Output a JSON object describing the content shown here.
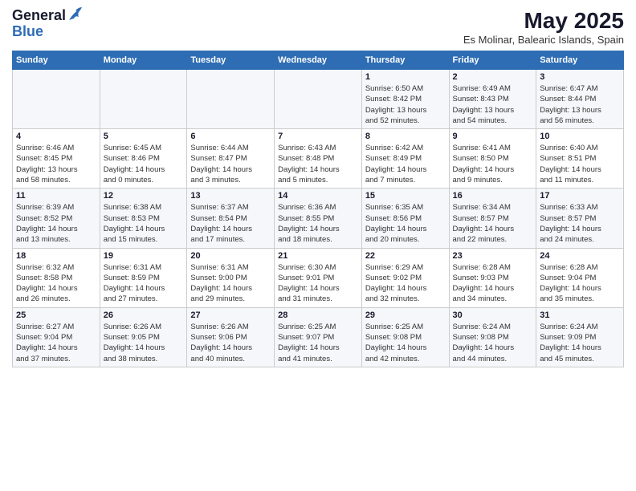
{
  "logo": {
    "general": "General",
    "blue": "Blue"
  },
  "title": "May 2025",
  "location": "Es Molinar, Balearic Islands, Spain",
  "headers": [
    "Sunday",
    "Monday",
    "Tuesday",
    "Wednesday",
    "Thursday",
    "Friday",
    "Saturday"
  ],
  "weeks": [
    [
      {
        "day": "",
        "info": ""
      },
      {
        "day": "",
        "info": ""
      },
      {
        "day": "",
        "info": ""
      },
      {
        "day": "",
        "info": ""
      },
      {
        "day": "1",
        "info": "Sunrise: 6:50 AM\nSunset: 8:42 PM\nDaylight: 13 hours\nand 52 minutes."
      },
      {
        "day": "2",
        "info": "Sunrise: 6:49 AM\nSunset: 8:43 PM\nDaylight: 13 hours\nand 54 minutes."
      },
      {
        "day": "3",
        "info": "Sunrise: 6:47 AM\nSunset: 8:44 PM\nDaylight: 13 hours\nand 56 minutes."
      }
    ],
    [
      {
        "day": "4",
        "info": "Sunrise: 6:46 AM\nSunset: 8:45 PM\nDaylight: 13 hours\nand 58 minutes."
      },
      {
        "day": "5",
        "info": "Sunrise: 6:45 AM\nSunset: 8:46 PM\nDaylight: 14 hours\nand 0 minutes."
      },
      {
        "day": "6",
        "info": "Sunrise: 6:44 AM\nSunset: 8:47 PM\nDaylight: 14 hours\nand 3 minutes."
      },
      {
        "day": "7",
        "info": "Sunrise: 6:43 AM\nSunset: 8:48 PM\nDaylight: 14 hours\nand 5 minutes."
      },
      {
        "day": "8",
        "info": "Sunrise: 6:42 AM\nSunset: 8:49 PM\nDaylight: 14 hours\nand 7 minutes."
      },
      {
        "day": "9",
        "info": "Sunrise: 6:41 AM\nSunset: 8:50 PM\nDaylight: 14 hours\nand 9 minutes."
      },
      {
        "day": "10",
        "info": "Sunrise: 6:40 AM\nSunset: 8:51 PM\nDaylight: 14 hours\nand 11 minutes."
      }
    ],
    [
      {
        "day": "11",
        "info": "Sunrise: 6:39 AM\nSunset: 8:52 PM\nDaylight: 14 hours\nand 13 minutes."
      },
      {
        "day": "12",
        "info": "Sunrise: 6:38 AM\nSunset: 8:53 PM\nDaylight: 14 hours\nand 15 minutes."
      },
      {
        "day": "13",
        "info": "Sunrise: 6:37 AM\nSunset: 8:54 PM\nDaylight: 14 hours\nand 17 minutes."
      },
      {
        "day": "14",
        "info": "Sunrise: 6:36 AM\nSunset: 8:55 PM\nDaylight: 14 hours\nand 18 minutes."
      },
      {
        "day": "15",
        "info": "Sunrise: 6:35 AM\nSunset: 8:56 PM\nDaylight: 14 hours\nand 20 minutes."
      },
      {
        "day": "16",
        "info": "Sunrise: 6:34 AM\nSunset: 8:57 PM\nDaylight: 14 hours\nand 22 minutes."
      },
      {
        "day": "17",
        "info": "Sunrise: 6:33 AM\nSunset: 8:57 PM\nDaylight: 14 hours\nand 24 minutes."
      }
    ],
    [
      {
        "day": "18",
        "info": "Sunrise: 6:32 AM\nSunset: 8:58 PM\nDaylight: 14 hours\nand 26 minutes."
      },
      {
        "day": "19",
        "info": "Sunrise: 6:31 AM\nSunset: 8:59 PM\nDaylight: 14 hours\nand 27 minutes."
      },
      {
        "day": "20",
        "info": "Sunrise: 6:31 AM\nSunset: 9:00 PM\nDaylight: 14 hours\nand 29 minutes."
      },
      {
        "day": "21",
        "info": "Sunrise: 6:30 AM\nSunset: 9:01 PM\nDaylight: 14 hours\nand 31 minutes."
      },
      {
        "day": "22",
        "info": "Sunrise: 6:29 AM\nSunset: 9:02 PM\nDaylight: 14 hours\nand 32 minutes."
      },
      {
        "day": "23",
        "info": "Sunrise: 6:28 AM\nSunset: 9:03 PM\nDaylight: 14 hours\nand 34 minutes."
      },
      {
        "day": "24",
        "info": "Sunrise: 6:28 AM\nSunset: 9:04 PM\nDaylight: 14 hours\nand 35 minutes."
      }
    ],
    [
      {
        "day": "25",
        "info": "Sunrise: 6:27 AM\nSunset: 9:04 PM\nDaylight: 14 hours\nand 37 minutes."
      },
      {
        "day": "26",
        "info": "Sunrise: 6:26 AM\nSunset: 9:05 PM\nDaylight: 14 hours\nand 38 minutes."
      },
      {
        "day": "27",
        "info": "Sunrise: 6:26 AM\nSunset: 9:06 PM\nDaylight: 14 hours\nand 40 minutes."
      },
      {
        "day": "28",
        "info": "Sunrise: 6:25 AM\nSunset: 9:07 PM\nDaylight: 14 hours\nand 41 minutes."
      },
      {
        "day": "29",
        "info": "Sunrise: 6:25 AM\nSunset: 9:08 PM\nDaylight: 14 hours\nand 42 minutes."
      },
      {
        "day": "30",
        "info": "Sunrise: 6:24 AM\nSunset: 9:08 PM\nDaylight: 14 hours\nand 44 minutes."
      },
      {
        "day": "31",
        "info": "Sunrise: 6:24 AM\nSunset: 9:09 PM\nDaylight: 14 hours\nand 45 minutes."
      }
    ]
  ]
}
